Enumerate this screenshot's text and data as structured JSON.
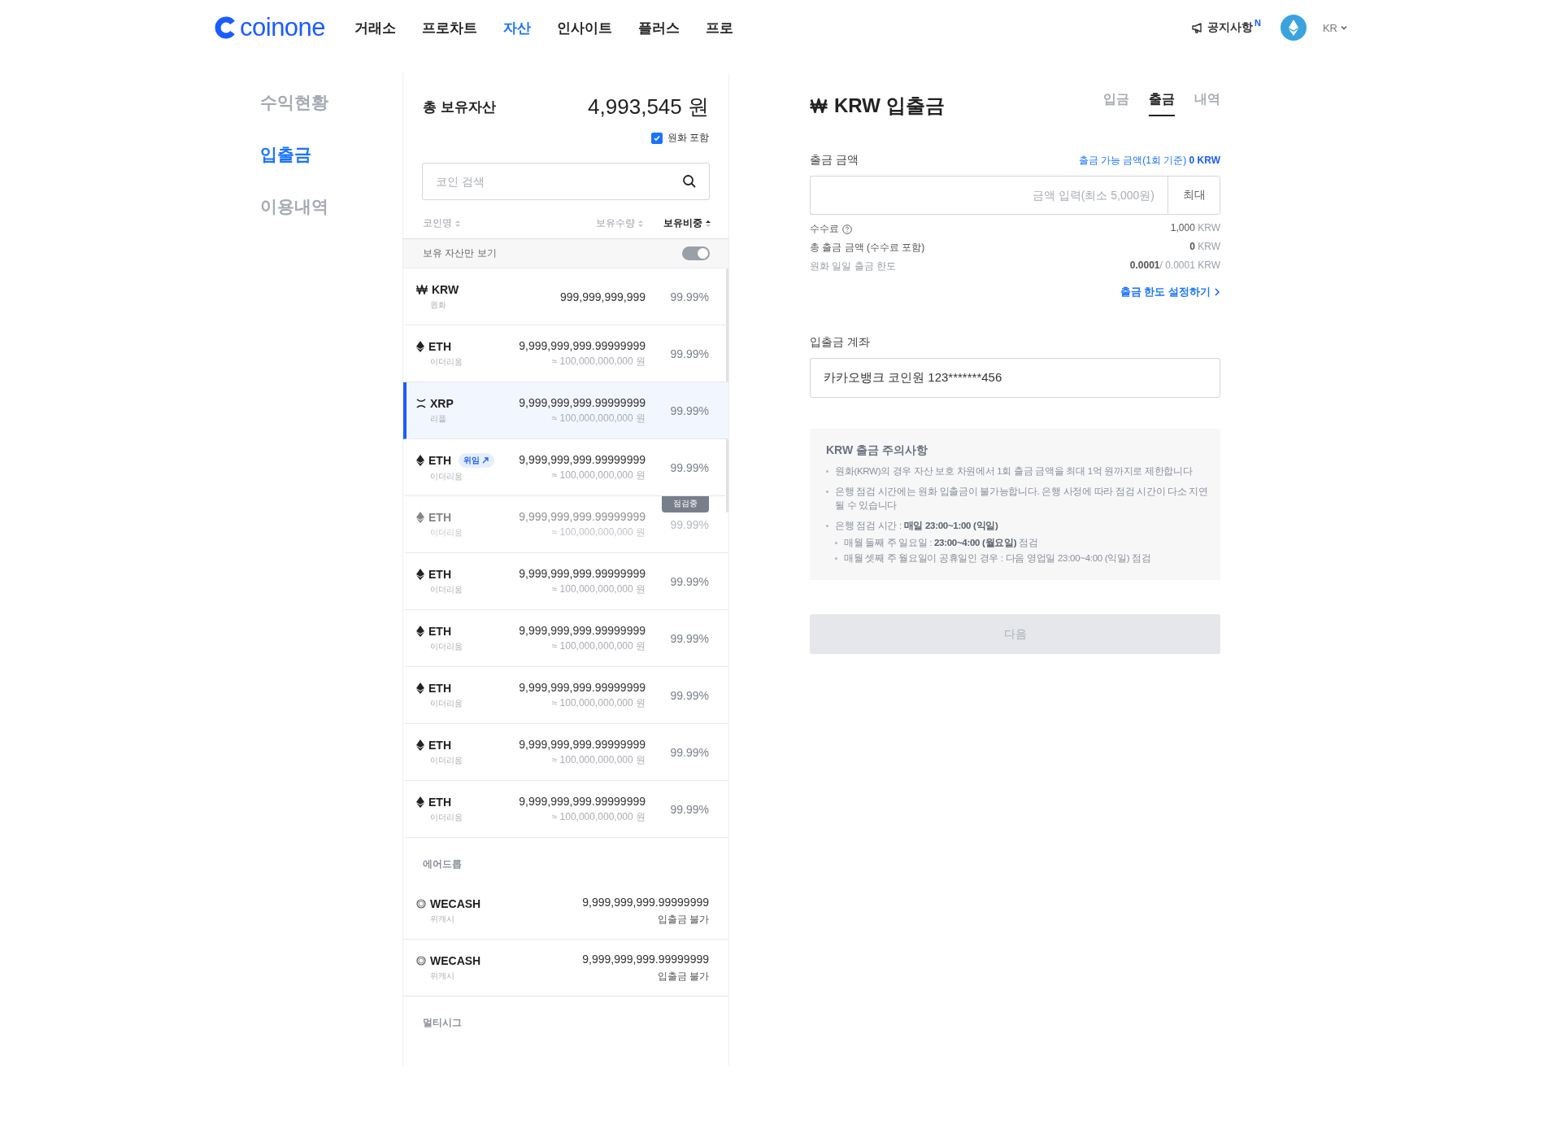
{
  "header": {
    "logo": "coinone",
    "nav": [
      {
        "label": "거래소",
        "selected": false
      },
      {
        "label": "프로차트",
        "selected": false
      },
      {
        "label": "자산",
        "selected": true
      },
      {
        "label": "인사이트",
        "selected": false
      },
      {
        "label": "플러스",
        "selected": false
      },
      {
        "label": "프로",
        "selected": false
      }
    ],
    "notice": "공지사항",
    "notice_badge": "N",
    "language": "KR"
  },
  "sidebar": {
    "items": [
      {
        "label": "수익현황",
        "selected": false
      },
      {
        "label": "입출금",
        "selected": true
      },
      {
        "label": "이용내역",
        "selected": false
      }
    ]
  },
  "assets": {
    "title": "총 보유자산",
    "total": "4,993,545 원",
    "include_krw": {
      "label": "원화 포함",
      "checked": true
    },
    "search": {
      "placeholder": "코인 검색"
    },
    "columns": [
      {
        "label": "코인명",
        "selected": false
      },
      {
        "label": "보유수량",
        "selected": false
      },
      {
        "label": "보유비중",
        "selected": true
      }
    ],
    "holdings_only": {
      "label": "보유 자산만 보기",
      "on": true
    },
    "rows": [
      {
        "kind": "won",
        "symbol": "KRW",
        "name": "원화",
        "amount": "999,999,999,999",
        "share": "99.99%",
        "selected": false,
        "maintenance": false
      },
      {
        "kind": "eth",
        "symbol": "ETH",
        "name": "이더리움",
        "amount": "9,999,999,999.99999999",
        "value": "≈ 100,000,000,000 원",
        "share": "99.99%",
        "selected": false,
        "maintenance": false
      },
      {
        "kind": "xrp",
        "symbol": "XRP",
        "name": "리플",
        "amount": "9,999,999,999.99999999",
        "value": "≈ 100,000,000,000 원",
        "share": "99.99%",
        "selected": true,
        "maintenance": false
      },
      {
        "kind": "eth",
        "symbol": "ETH",
        "badge": "위임",
        "name": "이더리움",
        "amount": "9,999,999,999.99999999",
        "value": "≈ 100,000,000,000 원",
        "share": "99.99%",
        "selected": false,
        "maintenance": false
      },
      {
        "kind": "eth",
        "symbol": "ETH",
        "name": "이더리움",
        "amount": "9,999,999,999.99999999",
        "value": "≈ 100,000,000,000 원",
        "share": "99.99%",
        "selected": false,
        "maintenance": true,
        "status": "점검중"
      },
      {
        "kind": "eth",
        "symbol": "ETH",
        "name": "이더리움",
        "amount": "9,999,999,999.99999999",
        "value": "≈ 100,000,000,000 원",
        "share": "99.99%",
        "selected": false,
        "maintenance": false
      },
      {
        "kind": "eth",
        "symbol": "ETH",
        "name": "이더리움",
        "amount": "9,999,999,999.99999999",
        "value": "≈ 100,000,000,000 원",
        "share": "99.99%",
        "selected": false,
        "maintenance": false
      },
      {
        "kind": "eth",
        "symbol": "ETH",
        "name": "이더리움",
        "amount": "9,999,999,999.99999999",
        "value": "≈ 100,000,000,000 원",
        "share": "99.99%",
        "selected": false,
        "maintenance": false
      },
      {
        "kind": "eth",
        "symbol": "ETH",
        "name": "이더리움",
        "amount": "9,999,999,999.99999999",
        "value": "≈ 100,000,000,000 원",
        "share": "99.99%",
        "selected": false,
        "maintenance": false
      },
      {
        "kind": "eth",
        "symbol": "ETH",
        "name": "이더리움",
        "amount": "9,999,999,999.99999999",
        "value": "≈ 100,000,000,000 원",
        "share": "99.99%",
        "selected": false,
        "maintenance": false
      }
    ],
    "sections": [
      {
        "title": "에어드롭",
        "rows": [
          {
            "kind": "ring",
            "symbol": "WECASH",
            "name": "위캐시",
            "amount": "9,999,999,999.99999999",
            "note": "입출금 불가"
          },
          {
            "kind": "ring",
            "symbol": "WECASH",
            "name": "위캐시",
            "amount": "9,999,999,999.99999999",
            "note": "입출금 불가"
          }
        ]
      },
      {
        "title": "멀티시그"
      }
    ]
  },
  "transfer": {
    "title": "KRW 입출금",
    "tabs": [
      {
        "label": "입금",
        "selected": false
      },
      {
        "label": "출금",
        "selected": true
      },
      {
        "label": "내역",
        "selected": false
      }
    ],
    "amount_label": "출금 금액",
    "available": "출금 가능 금액(1회 기준)",
    "available_value": "0 KRW",
    "amount_field": {
      "placeholder": "금액 입력(최소 5,000원)"
    },
    "max_button": "최대",
    "fees": [
      {
        "kind": "help",
        "label": "수수료",
        "value": "1,000",
        "unit": "KRW"
      },
      {
        "kind": "plain",
        "label": "총 출금 금액 (수수료 포함)",
        "value": "0",
        "unit": "KRW"
      },
      {
        "kind": "muted",
        "label": "원화 일일 출금 한도",
        "value": "0.0001",
        "extra": "/ 0.0001",
        "unit": "KRW"
      }
    ],
    "limit_link": "출금 한도 설정하기",
    "account_label": "입출금 계좌",
    "account": "카카오뱅크 코인원 123*******456",
    "notice_title": "KRW 출금 주의사항",
    "notices": [
      {
        "text": "원화(KRW)의 경우 자산 보호 차원에서 1회 출금 금액을 최대 1억 원까지로 제한합니다"
      },
      {
        "text": "은행 점검 시간에는 원화 입출금이 불가능합니다. 은행 사정에 따라 점검 시간이 다소 지연될 수 있습니다"
      },
      {
        "text": "은행 점검 시간 : **매일 23:00~1:00 (익일)**",
        "children": [
          {
            "text": "매월 둘째 주 일요일 : **23:00~4:00 (월요일)** 점검"
          },
          {
            "text": "매월 셋째 주 월요일이 공휴일인 경우 :  다음 영업일 23:00~4:00 (익일) 점검"
          }
        ]
      }
    ],
    "next_button": {
      "label": "다음",
      "disabled": true
    }
  }
}
